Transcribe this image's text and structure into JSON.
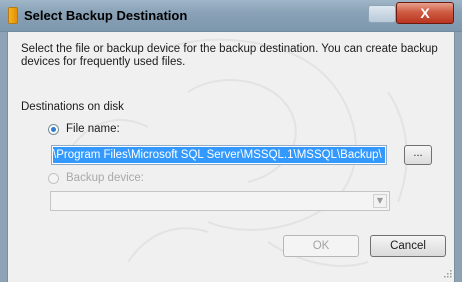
{
  "window": {
    "title": "Select Backup Destination",
    "close_glyph": "X",
    "accent_color": "#3399ff"
  },
  "content": {
    "description": "Select the file or backup device for the backup destination. You can create backup devices for frequently used files.",
    "destinations_label": "Destinations on disk",
    "file_name_option": {
      "label": "File name:",
      "selected": true
    },
    "file_path_value": "\\Program Files\\Microsoft SQL Server\\MSSQL.1\\MSSQL\\Backup\\",
    "browse_label": "...",
    "backup_device_option": {
      "label": "Backup device:",
      "selected": false,
      "enabled": false
    },
    "backup_device_value": ""
  },
  "buttons": {
    "ok_label": "OK",
    "cancel_label": "Cancel"
  },
  "icons": {
    "title_icon": "backup-file-icon",
    "minimize_icon": "minimize-icon",
    "close_icon": "close-icon",
    "dropdown_icon": "chevron-down-icon",
    "resize_icon": "resize-grip-icon"
  }
}
